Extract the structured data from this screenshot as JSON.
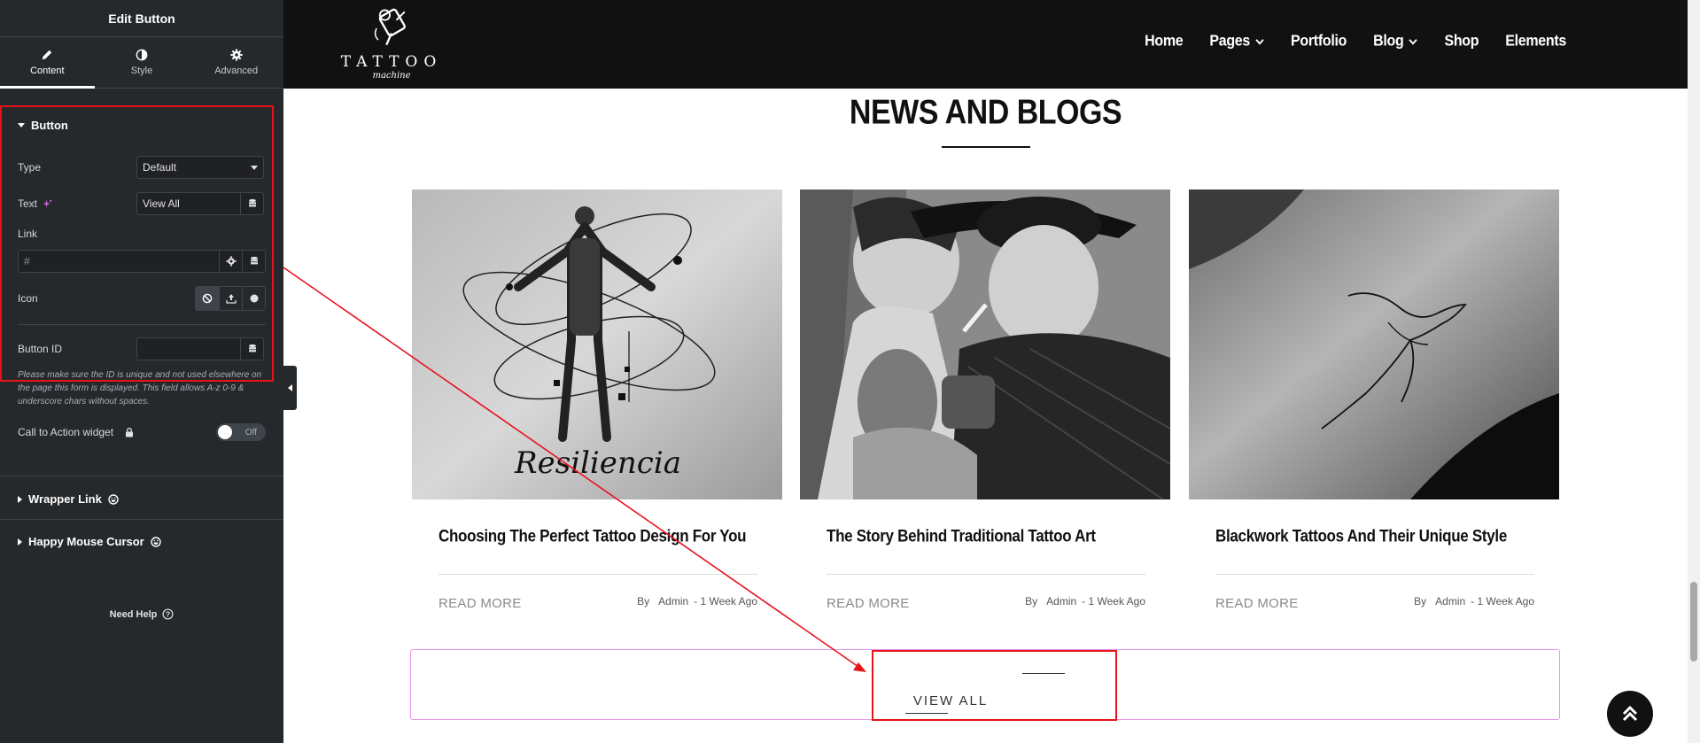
{
  "editor": {
    "title": "Edit Button",
    "tabs": [
      {
        "label": "Content",
        "icon": "pencil-icon"
      },
      {
        "label": "Style",
        "icon": "half-circle-icon"
      },
      {
        "label": "Advanced",
        "icon": "gear-icon"
      }
    ],
    "section_button": "Button",
    "type_label": "Type",
    "type_value": "Default",
    "text_label": "Text",
    "text_value": "View All",
    "link_label": "Link",
    "link_value": "#",
    "icon_label": "Icon",
    "button_id_label": "Button ID",
    "button_id_value": "",
    "help_text": "Please make sure the ID is unique and not used elsewhere on the page this form is displayed. This field allows A-z  0-9 & underscore chars without spaces.",
    "cta_label": "Call to Action widget",
    "cta_toggle": "Off",
    "section_wrapper": "Wrapper Link",
    "section_cursor": "Happy Mouse Cursor",
    "need_help": "Need Help"
  },
  "site": {
    "logo_text": "TATTOO",
    "logo_sub": "machine",
    "nav": [
      {
        "label": "Home",
        "dropdown": false
      },
      {
        "label": "Pages",
        "dropdown": true
      },
      {
        "label": "Portfolio",
        "dropdown": false
      },
      {
        "label": "Blog",
        "dropdown": true
      },
      {
        "label": "Shop",
        "dropdown": false
      },
      {
        "label": "Elements",
        "dropdown": false
      }
    ],
    "section_title": "NEWS AND BLOGS",
    "posts": [
      {
        "title": "Choosing The Perfect Tattoo Design For You",
        "read_more": "READ MORE",
        "by": "By",
        "author": "Admin",
        "date": "- 1 Week Ago",
        "caption": "Resiliencia"
      },
      {
        "title": "The Story Behind Traditional Tattoo Art",
        "read_more": "READ MORE",
        "by": "By",
        "author": "Admin",
        "date": "- 1 Week Ago"
      },
      {
        "title": "Blackwork Tattoos And Their Unique Style",
        "read_more": "READ MORE",
        "by": "By",
        "author": "Admin",
        "date": "- 1 Week Ago"
      }
    ],
    "view_all": "VIEW ALL"
  },
  "colors": {
    "panel_bg": "#26292c",
    "header_bg": "#111111",
    "highlight_red": "#e8121b",
    "wrapper_outline": "#e796e7"
  }
}
